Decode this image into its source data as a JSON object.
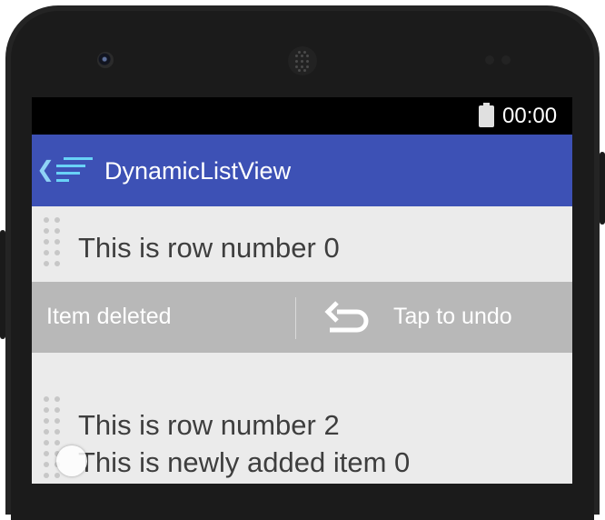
{
  "status_bar": {
    "time": "00:00",
    "icons": [
      "battery-icon"
    ]
  },
  "app_bar": {
    "title": "DynamicListView",
    "icons": [
      "back-chevron-icon",
      "app-list-icon"
    ]
  },
  "list": {
    "rows": [
      {
        "text": "This is row number 0"
      },
      {
        "text": "This is row number 2"
      },
      {
        "text": "This is newly added item 0"
      }
    ]
  },
  "snackbar": {
    "message": "Item deleted",
    "action": "Tap to undo",
    "icon": "undo-icon"
  },
  "colors": {
    "app_bar": "#3d51b5",
    "status_bar": "#000000",
    "list_background": "#ebebeb",
    "snackbar": "#b8b8b8"
  }
}
